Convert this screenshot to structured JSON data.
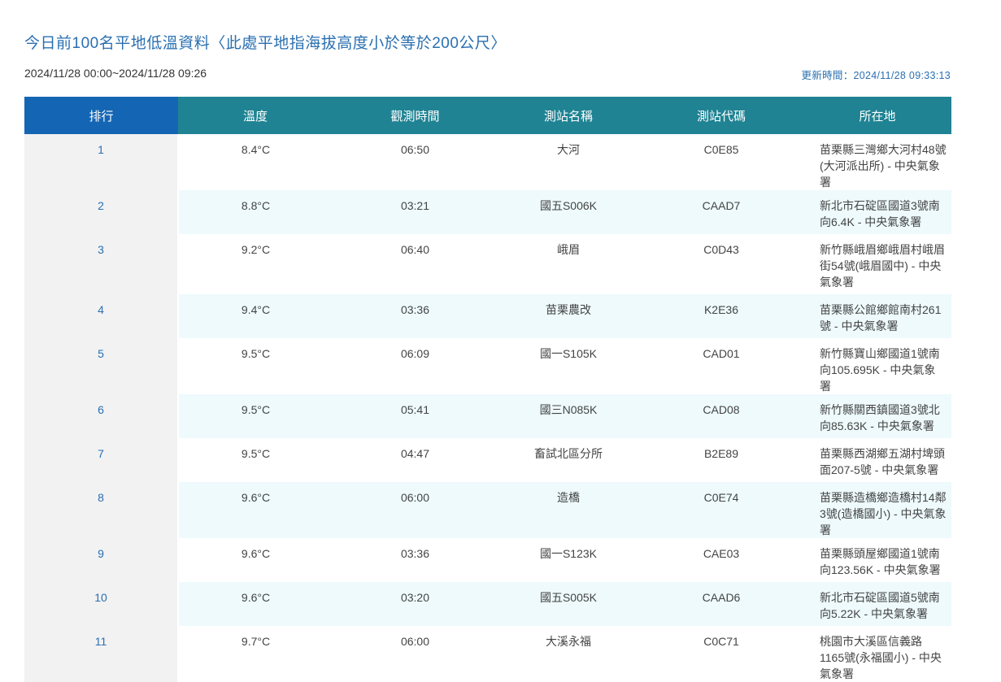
{
  "page": {
    "title": "今日前100名平地低溫資料〈此處平地指海拔高度小於等於200公尺〉",
    "date_range": "2024/11/28 00:00~2024/11/28 09:26",
    "updated": "更新時間：2024/11/28 09:33:13"
  },
  "table": {
    "headers": {
      "rank": "排行",
      "temp": "溫度",
      "time": "觀測時間",
      "station_name": "測站名稱",
      "station_code": "測站代碼",
      "location": "所在地"
    },
    "rows": [
      {
        "rank": "1",
        "temp": "8.4°C",
        "time": "06:50",
        "name": "大河",
        "code": "C0E85",
        "loc": "苗栗縣三灣鄉大河村48號(大河派出所) - 中央氣象署"
      },
      {
        "rank": "2",
        "temp": "8.8°C",
        "time": "03:21",
        "name": "國五S006K",
        "code": "CAAD7",
        "loc": "新北市石碇區國道3號南向6.4K - 中央氣象署"
      },
      {
        "rank": "3",
        "temp": "9.2°C",
        "time": "06:40",
        "name": "峨眉",
        "code": "C0D43",
        "loc": "新竹縣峨眉鄉峨眉村峨眉街54號(峨眉國中) - 中央氣象署"
      },
      {
        "rank": "4",
        "temp": "9.4°C",
        "time": "03:36",
        "name": "苗栗農改",
        "code": "K2E36",
        "loc": "苗栗縣公館鄉館南村261號 - 中央氣象署"
      },
      {
        "rank": "5",
        "temp": "9.5°C",
        "time": "06:09",
        "name": "國一S105K",
        "code": "CAD01",
        "loc": "新竹縣寶山鄉國道1號南向105.695K - 中央氣象署"
      },
      {
        "rank": "6",
        "temp": "9.5°C",
        "time": "05:41",
        "name": "國三N085K",
        "code": "CAD08",
        "loc": "新竹縣關西鎮國道3號北向85.63K - 中央氣象署"
      },
      {
        "rank": "7",
        "temp": "9.5°C",
        "time": "04:47",
        "name": "畜試北區分所",
        "code": "B2E89",
        "loc": "苗栗縣西湖鄉五湖村埤頭面207-5號 - 中央氣象署"
      },
      {
        "rank": "8",
        "temp": "9.6°C",
        "time": "06:00",
        "name": "造橋",
        "code": "C0E74",
        "loc": "苗栗縣造橋鄉造橋村14鄰3號(造橋國小) - 中央氣象署"
      },
      {
        "rank": "9",
        "temp": "9.6°C",
        "time": "03:36",
        "name": "國一S123K",
        "code": "CAE03",
        "loc": "苗栗縣頭屋鄉國道1號南向123.56K - 中央氣象署"
      },
      {
        "rank": "10",
        "temp": "9.6°C",
        "time": "03:20",
        "name": "國五S005K",
        "code": "CAAD6",
        "loc": "新北市石碇區國道5號南向5.22K - 中央氣象署"
      },
      {
        "rank": "11",
        "temp": "9.7°C",
        "time": "06:00",
        "name": "大溪永福",
        "code": "C0C71",
        "loc": "桃園市大溪區信義路1165號(永福國小) - 中央氣象署"
      }
    ]
  }
}
